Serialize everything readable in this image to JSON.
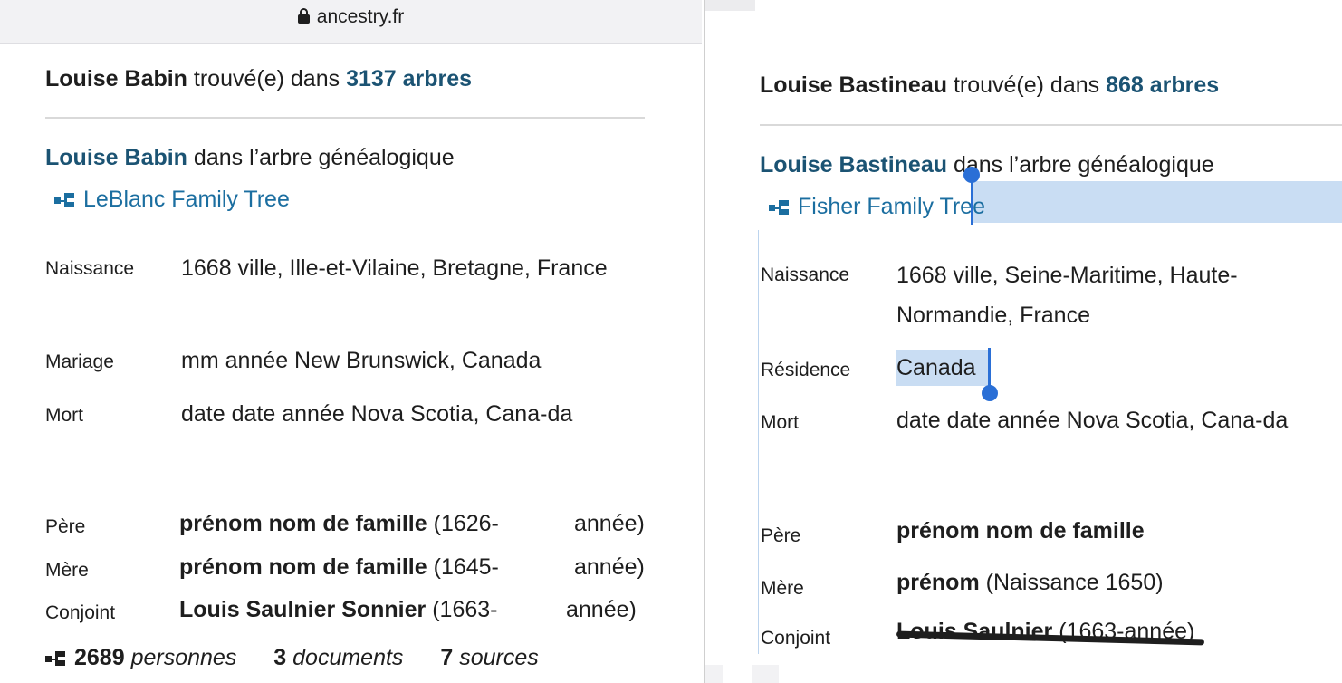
{
  "browser": {
    "url": "ancestry.fr"
  },
  "left": {
    "headline": {
      "name": "Louise Babin",
      "found_in": " trouvé(e) dans ",
      "count": "3137 arbres"
    },
    "record_heading": {
      "name": "Louise Babin",
      "suffix": " dans l’arbre généalogique"
    },
    "tree_name": "LeBlanc Family Tree",
    "facts": [
      {
        "label": "Naissance",
        "value": "1668 ville, Ille-et-Vilaine, Bretagne, France"
      },
      {
        "label": "Mariage",
        "value": "mm année New Brunswick, Canada"
      },
      {
        "label": "Mort",
        "value": "date date année Nova Scotia, Cana-da"
      }
    ],
    "relatives": [
      {
        "label": "Père",
        "name": "prénom nom de famille",
        "years": " (1626-",
        "end": "année)"
      },
      {
        "label": "Mère",
        "name": "prénom nom de famille",
        "years": " (1645-",
        "end": "année)"
      },
      {
        "label": "Conjoint",
        "name": "Louis Saulnier Sonnier",
        "years": " (1663-",
        "end": "année)"
      }
    ],
    "stats": {
      "persons_count": "2689",
      "persons_label": "personnes",
      "documents_count": "3",
      "documents_label": "documents",
      "sources_count": "7",
      "sources_label": "sources"
    }
  },
  "right": {
    "headline": {
      "name": "Louise Bastineau",
      "found_in": " trouvé(e) dans ",
      "count": "868 arbres"
    },
    "record_heading": {
      "name": "Louise Bastineau",
      "suffix": " dans l’arbre généalogique"
    },
    "tree_name": "Fisher Family Tree",
    "facts": [
      {
        "label": "Naissance",
        "value": "1668 ville, Seine-Maritime, Haute-Normandie, France"
      },
      {
        "label": "Résidence",
        "value": "Canada"
      },
      {
        "label": "Mort",
        "value": "date date année Nova Scotia, Cana-da"
      }
    ],
    "relatives": [
      {
        "label": "Père",
        "name": "prénom nom de famille",
        "extra": ""
      },
      {
        "label": "Mère",
        "name": "prénom",
        "extra": " (Naissance 1650)"
      },
      {
        "label": "Conjoint",
        "name": "Louis Saulnier",
        "extra": " (1663-année)"
      }
    ]
  },
  "colors": {
    "link_dark": "#1b5373",
    "link_blue": "#1b6ea0",
    "selection": "#c9ddf3",
    "caret": "#2a6fd6"
  },
  "icons": [
    "lock-icon",
    "family-tree-icon"
  ]
}
